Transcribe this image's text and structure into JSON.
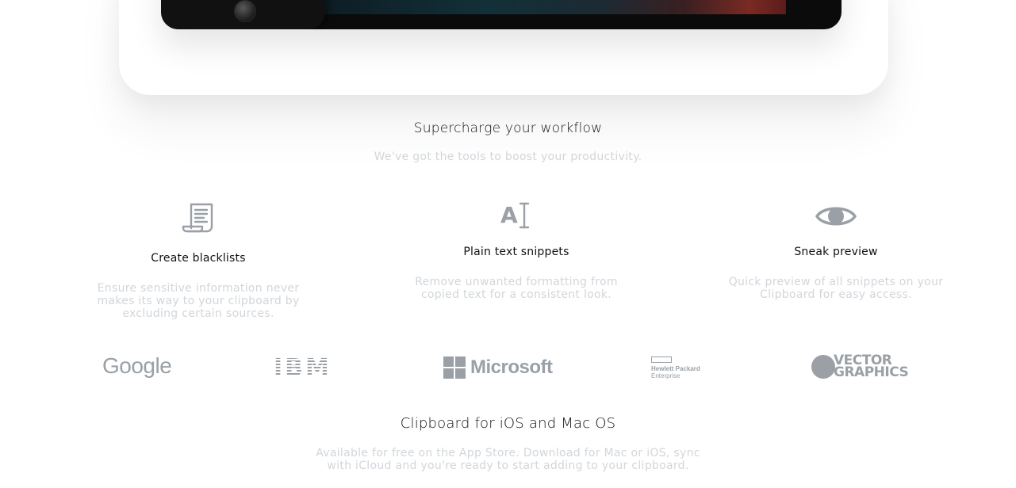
{
  "workflow": {
    "title": "Supercharge your workflow",
    "subtitle": "We've got the tools to boost your productivity."
  },
  "features": [
    {
      "icon": "scroll-document-icon",
      "title": "Create blacklists",
      "desc_lines": [
        "Ensure sensitive information never",
        "makes its way to your clipboard by",
        "excluding certain sources."
      ]
    },
    {
      "icon": "text-cursor-icon",
      "icon_text": "A",
      "title": "Plain text snippets",
      "desc_lines": [
        "Remove unwanted formatting from",
        "copied text for a consistent look."
      ]
    },
    {
      "icon": "eye-icon",
      "title": "Sneak preview",
      "desc_lines": [
        "Quick preview of all snippets on your",
        "Clipboard for easy access."
      ]
    }
  ],
  "logos": {
    "google": "Google",
    "ibm": "IBM",
    "microsoft": "Microsoft",
    "hp_line1": "Hewlett Packard",
    "hp_line2": "Enterprise",
    "vg_line1": "VECTOR",
    "vg_line2": "GRAPHICS"
  },
  "platforms": {
    "title": "Clipboard for iOS and Mac OS",
    "desc_lines": [
      "Available for free on the App Store. Download for Mac or iOS, sync",
      "with iCloud and you're ready to start adding to your clipboard."
    ]
  },
  "colors": {
    "heading": "#111111",
    "muted_text": "#d2d6da",
    "icon": "#9aa0a6",
    "logo": "#9aa0a6"
  }
}
